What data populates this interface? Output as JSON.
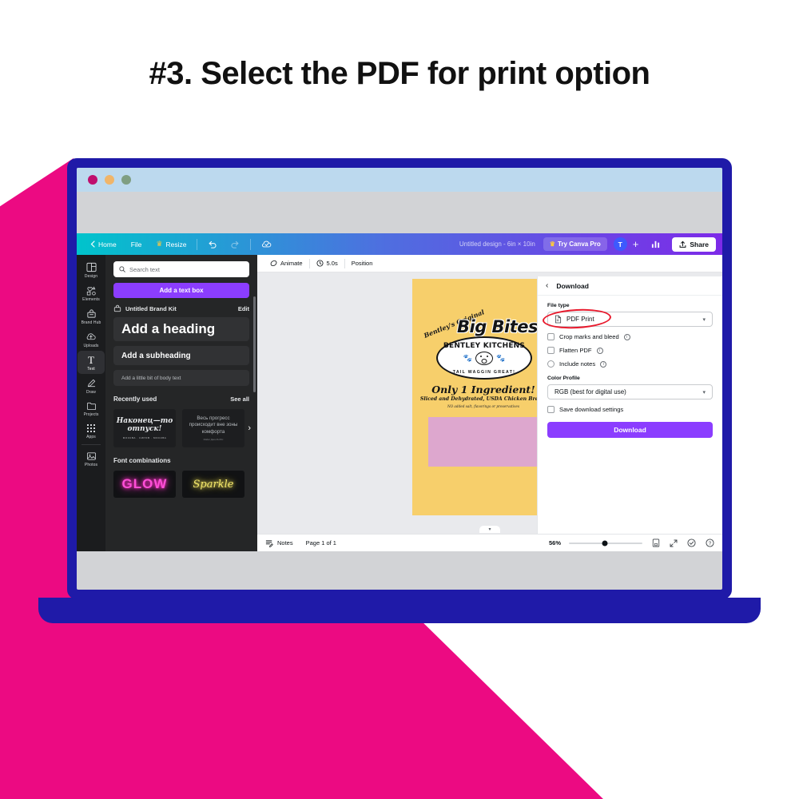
{
  "headline": "#3. Select the PDF for print option",
  "window_controls": {
    "close": "close-dot",
    "minimize": "minimize-dot",
    "maximize": "maximize-dot"
  },
  "topbar": {
    "home": "Home",
    "file": "File",
    "resize": "Resize",
    "undo": "undo-icon",
    "redo": "redo-icon",
    "cloud": "cloud-save-icon",
    "doc_title": "Untitled design - 6in × 10in",
    "try_pro": "Try Canva Pro",
    "avatar_initial": "T",
    "plus": "+",
    "insights": "insights-icon",
    "share": "Share"
  },
  "rail": {
    "items": [
      {
        "label": "Design",
        "icon": "design-icon",
        "active": false
      },
      {
        "label": "Elements",
        "icon": "elements-icon",
        "active": false
      },
      {
        "label": "Brand Hub",
        "icon": "brand-hub-icon",
        "active": false
      },
      {
        "label": "Uploads",
        "icon": "uploads-icon",
        "active": false
      },
      {
        "label": "Text",
        "icon": "text-icon",
        "active": true
      },
      {
        "label": "Draw",
        "icon": "draw-icon",
        "active": false
      },
      {
        "label": "Projects",
        "icon": "projects-icon",
        "active": false
      },
      {
        "label": "Apps",
        "icon": "apps-icon",
        "active": false
      },
      {
        "label": "Photos",
        "icon": "photos-icon",
        "active": false
      }
    ]
  },
  "text_panel": {
    "search_placeholder": "Search text",
    "add_text_box": "Add a text box",
    "brand_kit": "Untitled Brand Kit",
    "edit": "Edit",
    "heading": "Add a heading",
    "subheading": "Add a subheading",
    "body": "Add a little bit of body text",
    "recently_used": "Recently used",
    "see_all": "See all",
    "recent_1": "Наконец—то отпуск!",
    "recent_1_sub": "МОСКВА · КИРОВ · МОСКВА",
    "recent_2": "Весь прогресс происходит вне зоны комфорта",
    "recent_2_sub": "Майкл Джон Боббс",
    "font_combinations": "Font combinations",
    "combo_1": "GLOW",
    "combo_2": "Sparkle"
  },
  "canvas_toolbar": {
    "animate": "Animate",
    "duration": "5.0s",
    "position": "Position",
    "lock": "lock-icon"
  },
  "design": {
    "brand_top": "Bentley's Original",
    "product": "Big Bites",
    "badge_top": "BENTLEY KITCHENS",
    "badge_bottom": "TAIL WAGGIN GREAT!",
    "claim": "Only 1 Ingredient!",
    "desc": "Sliced and Dehydrated, USDA Chicken Breast",
    "fine_print": "NO added salt, flavorings or preservatives",
    "bg_color": "#f7cf6b",
    "box_color": "#dda7ce"
  },
  "download_panel": {
    "back": "back-icon",
    "title": "Download",
    "file_type_label": "File type",
    "file_type_value": "PDF Print",
    "crop_marks": "Crop marks and bleed",
    "flatten": "Flatten PDF",
    "include_notes": "Include notes",
    "color_profile_label": "Color Profile",
    "color_profile_value": "RGB (best for digital use)",
    "save_settings": "Save download settings",
    "download_button": "Download",
    "accent_color": "#8b3dff",
    "highlight_color": "#e8192c"
  },
  "bottom_bar": {
    "notes": "Notes",
    "page": "Page 1 of 1",
    "zoom": "56%",
    "page_view": "page-view-icon",
    "fullscreen": "fullscreen-icon",
    "check": "check-icon",
    "help": "help-icon"
  },
  "colors": {
    "pink": "#ec0a82",
    "laptop": "#1f1aa8",
    "canva_purple": "#8b3dff"
  }
}
